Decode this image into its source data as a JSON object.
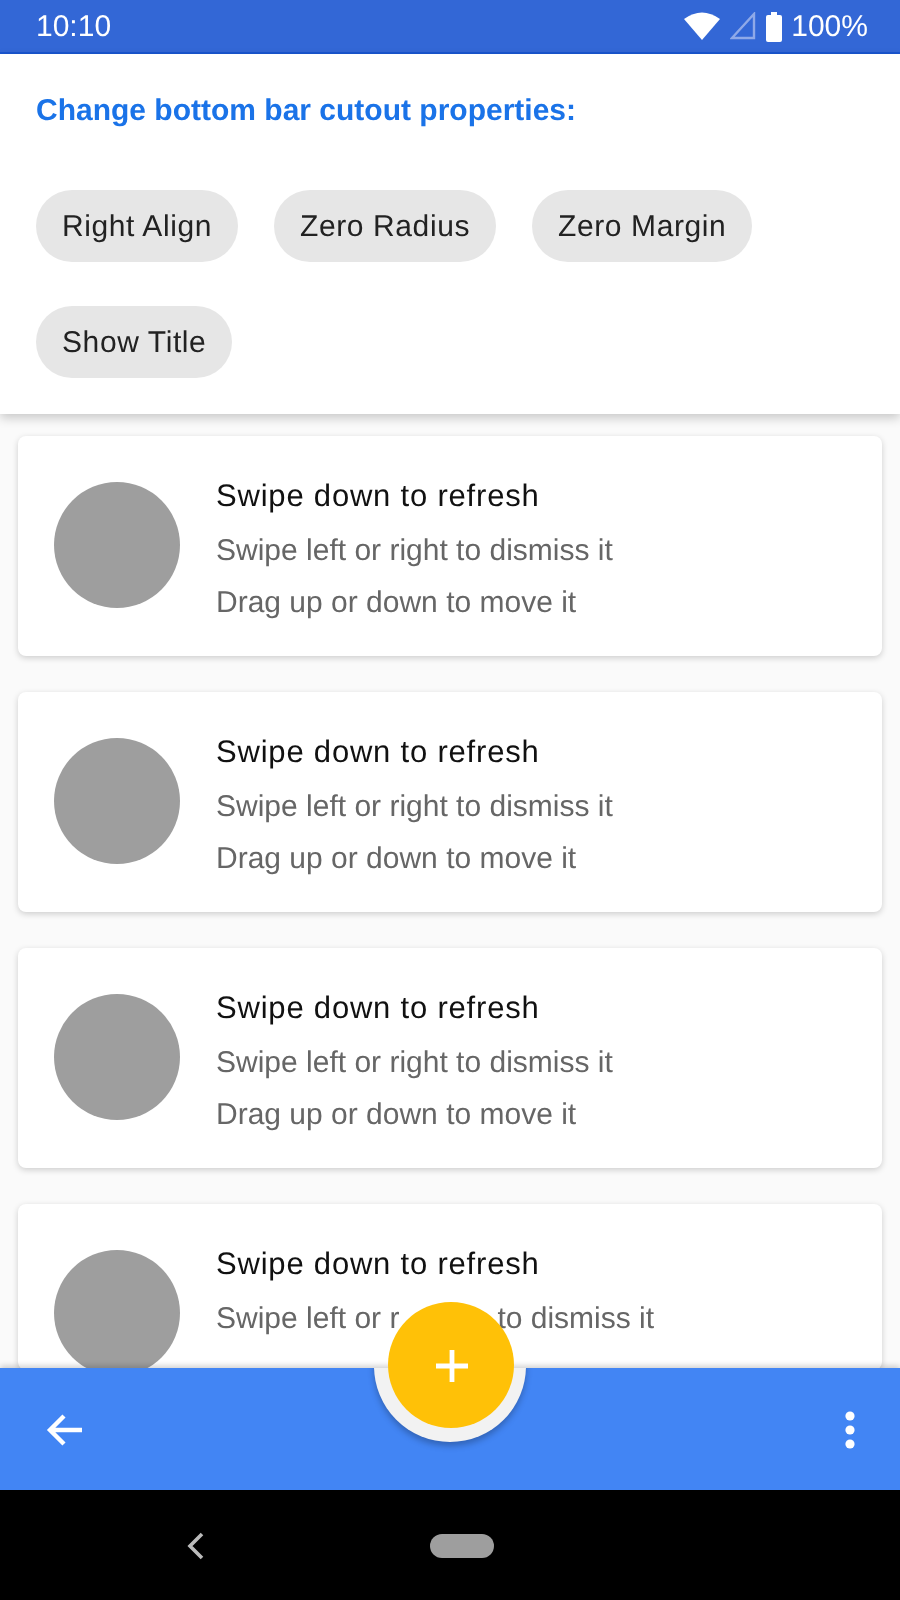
{
  "status_bar": {
    "time": "10:10",
    "battery": "100%"
  },
  "header": {
    "title": "Change bottom bar cutout properties:",
    "chips": [
      {
        "label": "Right Align"
      },
      {
        "label": "Zero Radius"
      },
      {
        "label": "Zero Margin"
      },
      {
        "label": "Show Title"
      }
    ]
  },
  "cards": [
    {
      "title": "Swipe down to refresh",
      "lines": [
        [
          "Swipe left or right to dismiss it"
        ],
        [
          "Drag up or down to move it"
        ]
      ]
    },
    {
      "title": "Swipe down to refresh",
      "lines": [
        [
          "Swipe left or right to dismiss it"
        ],
        [
          "Drag up or down to move it"
        ]
      ]
    },
    {
      "title": "Swipe down to refresh",
      "lines": [
        [
          "Swipe left or right to dismiss it"
        ],
        [
          "Drag up or down to move it"
        ]
      ]
    },
    {
      "title": "Swipe down to refresh",
      "lines": [
        [
          "Swipe left or r",
          "to dismiss it"
        ]
      ]
    }
  ]
}
